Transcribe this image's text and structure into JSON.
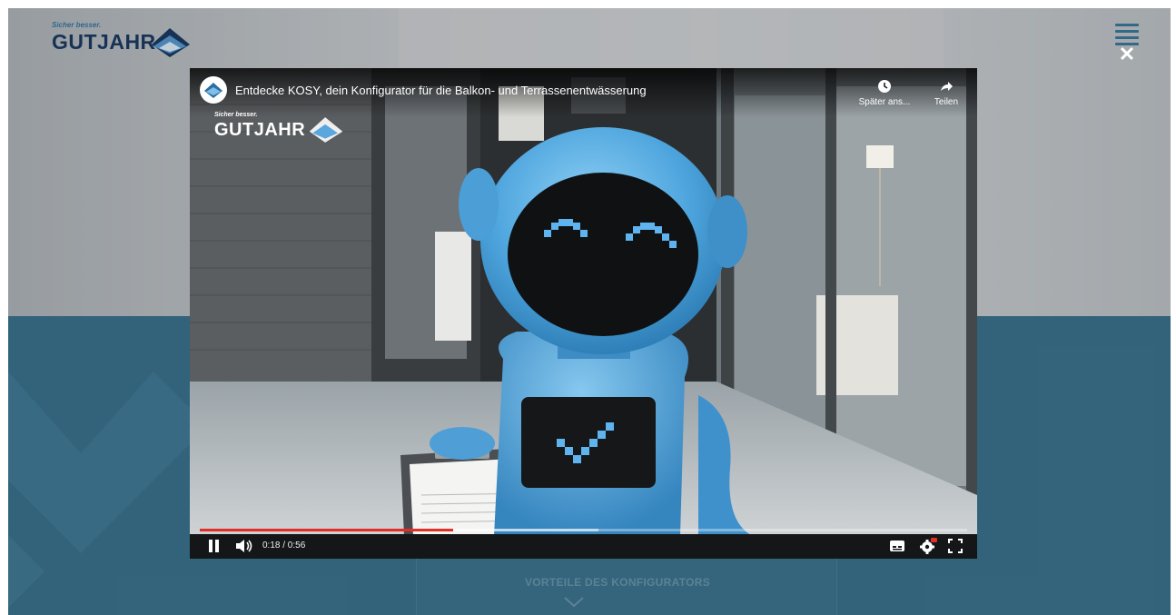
{
  "site": {
    "logo": {
      "tagline": "Sicher besser.",
      "wordmark": "GUTJAHR"
    },
    "section_heading": "VORTEILE DES KONFIGURATORS",
    "menu_icon": "hamburger-icon",
    "close_icon": "close-icon"
  },
  "video": {
    "title": "Entdecke KOSY, dein Konfigurator für die Balkon- und Terrassenentwässerung",
    "watch_later_label": "Später ans...",
    "share_label": "Teilen",
    "watermark": {
      "tagline": "Sicher besser.",
      "wordmark": "GUTJAHR"
    },
    "time_display": "0:18 / 0:56",
    "progress_played": 0.33,
    "progress_buffered": 0.52,
    "state": "playing",
    "icons": {
      "pause": "pause-icon",
      "volume": "volume-icon",
      "subtitles": "subtitles-icon",
      "settings": "settings-gear-icon",
      "fullscreen": "fullscreen-icon",
      "watch_later": "clock-icon",
      "share": "share-arrow-icon"
    }
  },
  "colors": {
    "brand_navy": "#0b2b55",
    "brand_blue": "#2d6783",
    "progress_red": "#e52d27"
  }
}
